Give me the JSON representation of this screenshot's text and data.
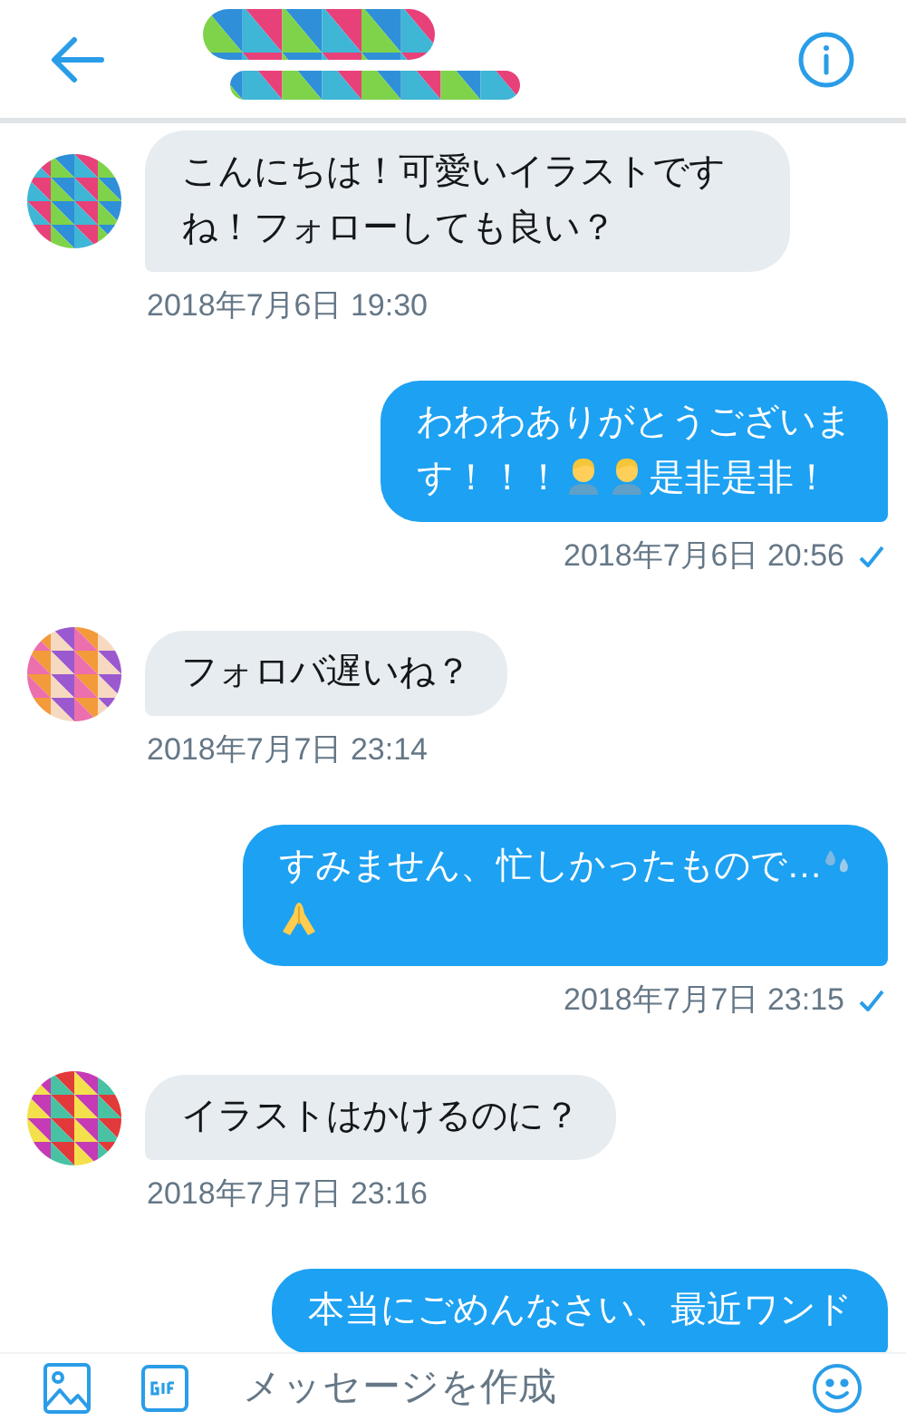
{
  "messages": [
    {
      "kind": "received",
      "parts": [
        {
          "kind": "text",
          "text": "こんにちは！可愛いイラストですね！フォローしても良い？"
        }
      ],
      "time": "2018年7月6日 19:30"
    },
    {
      "kind": "sent",
      "read": true,
      "parts": [
        {
          "kind": "text",
          "text": "わわわありがとうございま"
        },
        {
          "kind": "break"
        },
        {
          "kind": "text",
          "text": "す！！！"
        },
        {
          "kind": "person-emoji"
        },
        {
          "kind": "person-emoji"
        },
        {
          "kind": "text",
          "text": "是非是非！"
        }
      ],
      "time": "2018年7月6日 20:56"
    },
    {
      "kind": "received",
      "parts": [
        {
          "kind": "text",
          "text": "フォロバ遅いね？"
        }
      ],
      "time": "2018年7月7日 23:14"
    },
    {
      "kind": "sent",
      "read": true,
      "parts": [
        {
          "kind": "text",
          "text": "すみません、忙しかったもので…"
        },
        {
          "kind": "sweat-emoji"
        },
        {
          "kind": "break"
        },
        {
          "kind": "pray-emoji"
        }
      ],
      "time": "2018年7月7日 23:15"
    },
    {
      "kind": "received",
      "parts": [
        {
          "kind": "text",
          "text": "イラストはかけるのに？"
        }
      ],
      "time": "2018年7月7日 23:16"
    },
    {
      "kind": "sent",
      "parts": [
        {
          "kind": "text",
          "text": "本当にごめんなさい、最近ワンド"
        }
      ]
    }
  ],
  "composer": {
    "placeholder": "メッセージを作成"
  }
}
